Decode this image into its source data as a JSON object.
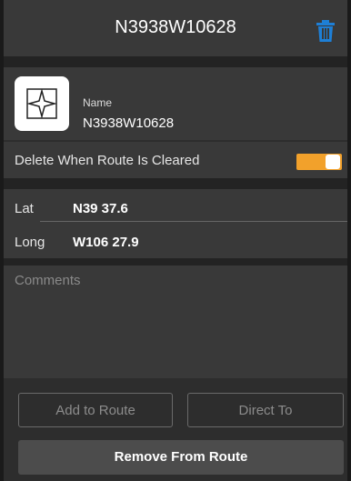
{
  "header": {
    "title": "N3938W10628",
    "delete_icon": "trash-icon",
    "accent_color": "#1e7fd6"
  },
  "waypoint": {
    "icon": "waypoint-star-icon",
    "name_label": "Name",
    "name_value": "N3938W10628"
  },
  "auto_delete": {
    "label": "Delete When Route Is Cleared",
    "enabled": true,
    "toggle_color": "#f2a12b"
  },
  "coordinates": {
    "lat_label": "Lat",
    "lat_value": "N39 37.6",
    "long_label": "Long",
    "long_value": "W106 27.9"
  },
  "comments": {
    "placeholder": "Comments"
  },
  "actions": {
    "add_to_route": "Add to Route",
    "direct_to": "Direct To",
    "remove_from_route": "Remove From Route"
  }
}
